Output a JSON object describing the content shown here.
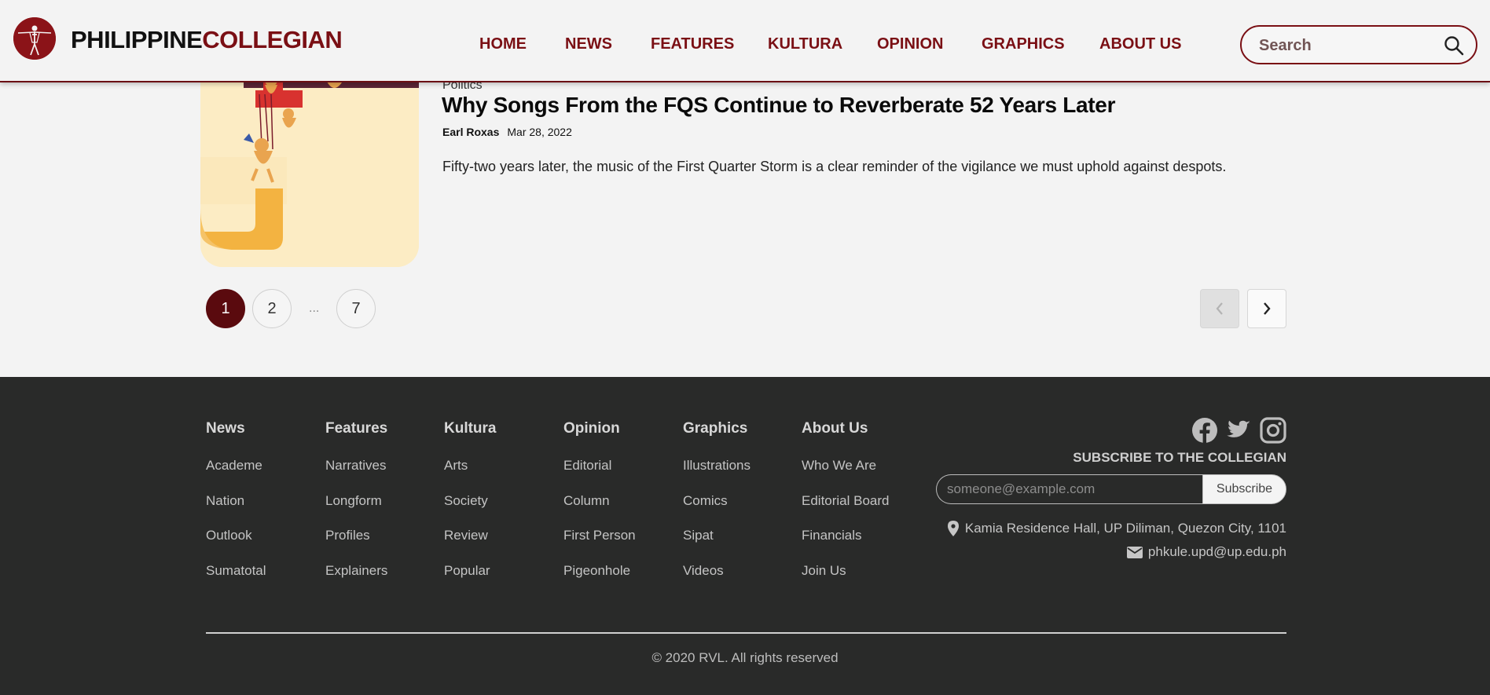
{
  "header": {
    "brand_part1": "PHILIPPINE",
    "brand_part2": "COLLEGIAN",
    "nav": [
      "HOME",
      "NEWS",
      "FEATURES",
      "KULTURA",
      "OPINION",
      "GRAPHICS",
      "ABOUT US"
    ],
    "search_placeholder": "Search"
  },
  "article": {
    "category": "Politics",
    "title": "Why Songs From the FQS Continue to Reverberate 52 Years Later",
    "author": "Earl Roxas",
    "date": "Mar 28, 2022",
    "excerpt": "Fifty-two years later, the music of the First Quarter Storm is a clear reminder of the vigilance we must uphold against despots."
  },
  "pagination": {
    "pages": [
      "1",
      "2",
      "7"
    ],
    "ellipsis": "...",
    "current": "1"
  },
  "footer": {
    "columns": [
      {
        "heading": "News",
        "links": [
          "Academe",
          "Nation",
          "Outlook",
          "Sumatotal"
        ]
      },
      {
        "heading": "Features",
        "links": [
          "Narratives",
          "Longform",
          "Profiles",
          "Explainers"
        ]
      },
      {
        "heading": "Kultura",
        "links": [
          "Arts",
          "Society",
          "Review",
          "Popular"
        ]
      },
      {
        "heading": "Opinion",
        "links": [
          "Editorial",
          "Column",
          "First Person",
          "Pigeonhole"
        ]
      },
      {
        "heading": "Graphics",
        "links": [
          "Illustrations",
          "Comics",
          "Sipat",
          "Videos"
        ]
      },
      {
        "heading": "About Us",
        "links": [
          "Who We Are",
          "Editorial Board",
          "Financials",
          "Join Us"
        ]
      }
    ],
    "social_icons": [
      "facebook-icon",
      "twitter-icon",
      "instagram-icon"
    ],
    "subscribe_title": "SUBSCRIBE TO THE COLLEGIAN",
    "subscribe_placeholder": "someone@example.com",
    "subscribe_button": "Subscribe",
    "address": "Kamia Residence Hall, UP Diliman, Quezon City, 1101",
    "email": "phkule.upd@up.edu.ph",
    "copyright": "© 2020 RVL. All rights reserved"
  },
  "colors": {
    "brand_maroon": "#7a0f14",
    "active_page": "#5a0a0e",
    "footer_bg": "#292a29"
  }
}
